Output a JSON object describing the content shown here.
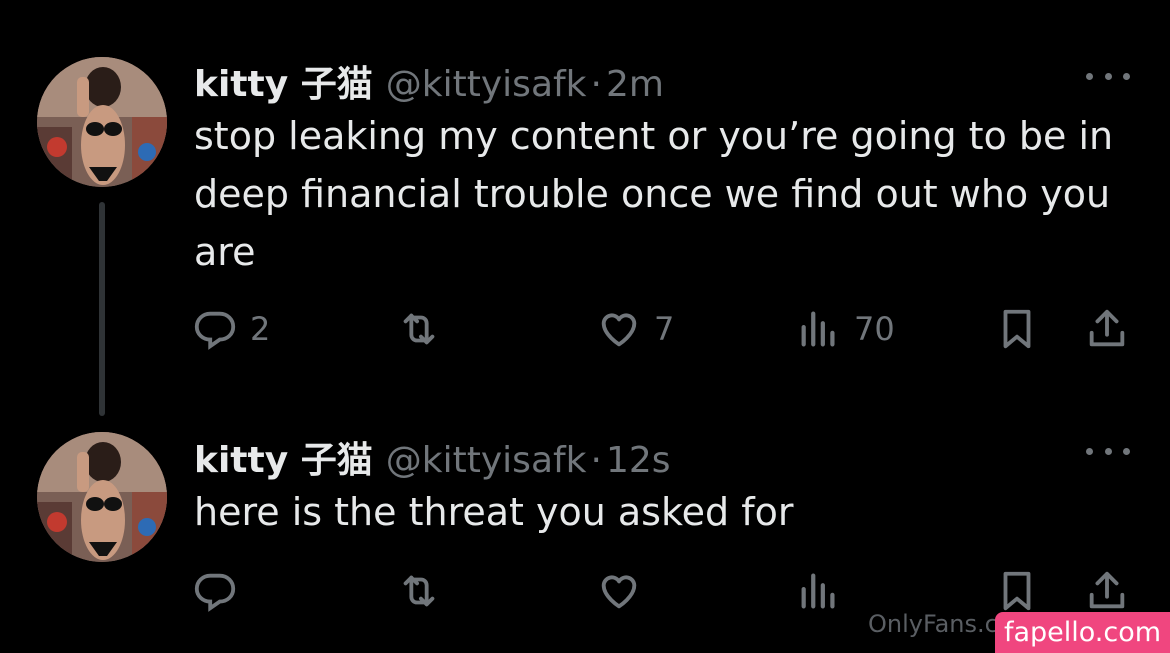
{
  "tweets": [
    {
      "name": "kitty 子猫",
      "handle": "@kittyisafk",
      "separator": "·",
      "time": "2m",
      "text": "stop leaking my content or you’re going to be in deep financial trouble once we find out who you are",
      "actions": {
        "replies": "2",
        "retweets": "",
        "likes": "7",
        "views": "70"
      }
    },
    {
      "name": "kitty 子猫",
      "handle": "@kittyisafk",
      "separator": "·",
      "time": "12s",
      "text": "here is the threat you asked for",
      "actions": {
        "replies": "",
        "retweets": "",
        "likes": "",
        "views": ""
      }
    }
  ],
  "watermark": {
    "left_text": "OnlyFans.c",
    "badge_text": "fapello.com"
  },
  "icons": {
    "reply": "reply-icon",
    "retweet": "retweet-icon",
    "like": "heart-icon",
    "views": "views-icon",
    "bookmark": "bookmark-icon",
    "share": "share-icon",
    "more": "more-icon"
  },
  "colors": {
    "background": "#000000",
    "text": "#e7e9ea",
    "secondary": "#71767b",
    "watermark": "#f0467f"
  }
}
